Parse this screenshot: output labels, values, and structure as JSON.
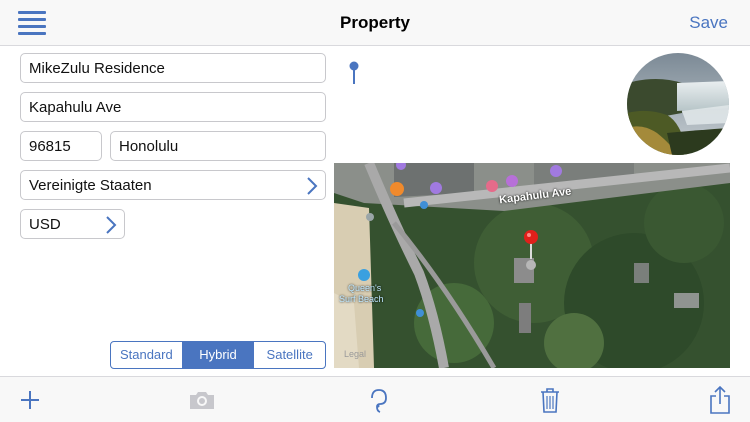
{
  "header": {
    "title": "Property",
    "save_label": "Save",
    "menu_icon": "hamburger-menu-icon"
  },
  "form": {
    "name": "MikeZulu Residence",
    "street": "Kapahulu Ave",
    "zip": "96815",
    "city": "Honolulu",
    "country": "Vereinigte Staaten",
    "currency": "USD"
  },
  "map": {
    "street_label": "Kapahulu Ave",
    "poi_label_line1": "Queen's",
    "poi_label_line2": "Surf Beach",
    "pin_color": "#e0201b",
    "map_types": [
      "Standard",
      "Hybrid",
      "Satellite"
    ],
    "selected_map_type": "Hybrid",
    "legal_label": "Legal"
  },
  "toolbar": {
    "icons": [
      "plus-icon",
      "camera-icon",
      "lasso-icon",
      "trash-icon",
      "share-icon"
    ]
  },
  "colors": {
    "accent": "#4a75c0",
    "disabled": "#c7c7cc"
  }
}
